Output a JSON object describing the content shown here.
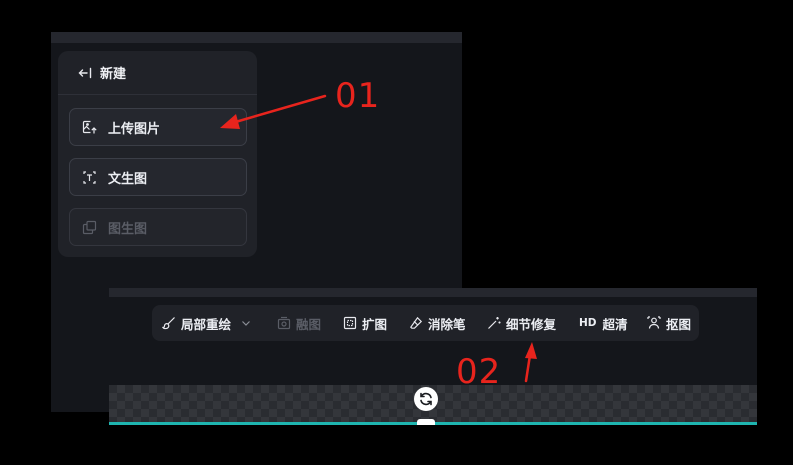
{
  "new_menu": {
    "title": "新建",
    "items": [
      {
        "label": "上传图片",
        "icon": "upload-image-icon",
        "enabled": true
      },
      {
        "label": "文生图",
        "icon": "text-to-image-icon",
        "enabled": true
      },
      {
        "label": "图生图",
        "icon": "image-to-image-icon",
        "enabled": false
      }
    ]
  },
  "toolbar": {
    "items": [
      {
        "label": "局部重绘",
        "icon": "inpaint-brush-icon",
        "enabled": true,
        "has_dropdown": true
      },
      {
        "label": "融图",
        "icon": "blend-image-icon",
        "enabled": false
      },
      {
        "label": "扩图",
        "icon": "expand-image-icon",
        "enabled": true
      },
      {
        "label": "消除笔",
        "icon": "eraser-icon",
        "enabled": true
      },
      {
        "label": "细节修复",
        "icon": "magic-wand-icon",
        "enabled": true
      },
      {
        "label": "超清",
        "prefix": "HD",
        "icon": "hd-icon",
        "enabled": true
      },
      {
        "label": "抠图",
        "icon": "cutout-person-icon",
        "enabled": true
      }
    ]
  },
  "annotations": {
    "step1": "01",
    "step2": "02",
    "color": "#e8241d"
  },
  "colors": {
    "panel_bg": "#14161b",
    "menu_bg": "#202228",
    "accent_line": "#1fb5b0"
  }
}
